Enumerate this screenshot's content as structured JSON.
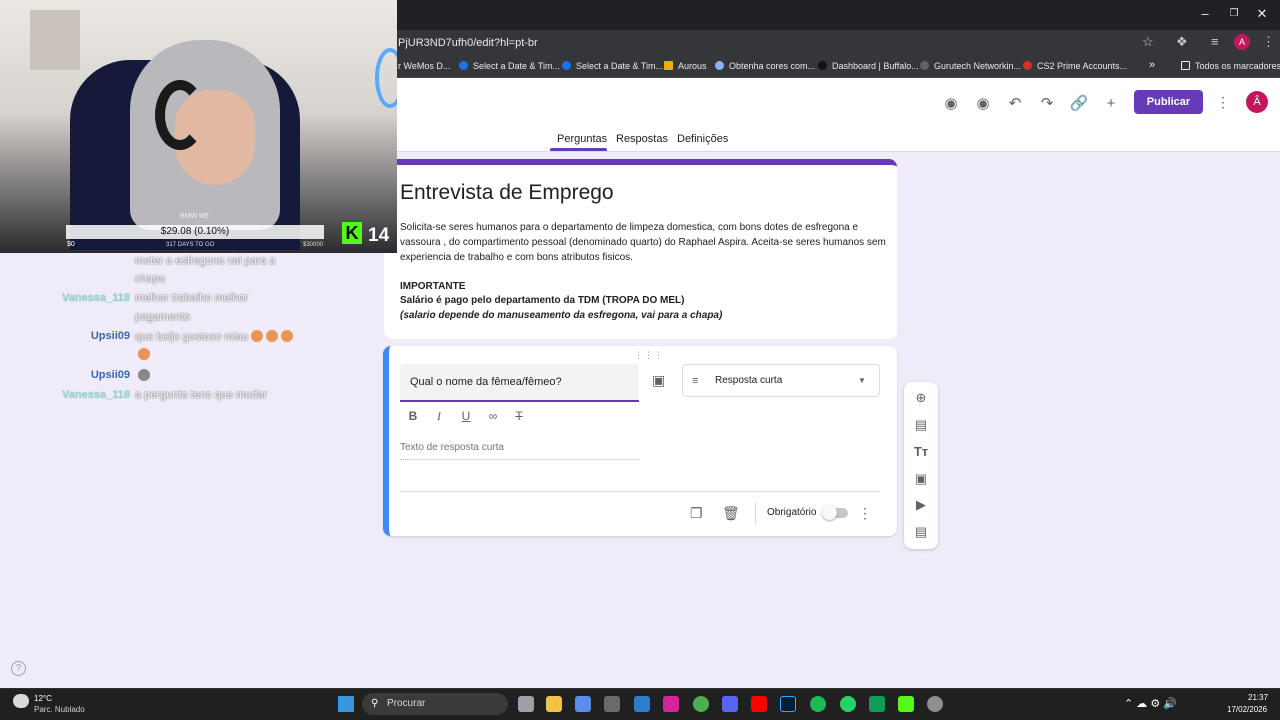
{
  "browser": {
    "url": "PjUR3ND7ufh0/edit?hl=pt-br",
    "profile_initial": "A",
    "bookmarks": [
      {
        "label": "r WeMos D...",
        "color": "#1a73e8"
      },
      {
        "label": "Select a Date & Tim...",
        "color": "#1a73e8"
      },
      {
        "label": "Select a Date & Tim...",
        "color": "#1a73e8"
      },
      {
        "label": "Aurous",
        "color": "#f9ab00"
      },
      {
        "label": "Obtenha cores com...",
        "color": "#8ab4f8"
      },
      {
        "label": "Dashboard | Buffalo...",
        "color": "#202124"
      },
      {
        "label": "Gurutech Networkin...",
        "color": "#5f6368"
      },
      {
        "label": "CS2 Prime Accounts...",
        "color": "#d93025"
      }
    ],
    "bookmarks_more": "»",
    "all_bookmarks": "Todos os marcadores"
  },
  "forms": {
    "publish_label": "Publicar",
    "avatar_initial": "Â",
    "tabs": [
      "Perguntas",
      "Respostas",
      "Definições"
    ],
    "title": "Entrevista de Emprego",
    "description": {
      "paragraph": "Solicita-se seres humanos para o departamento de limpeza domestica, com bons dotes de esfregona e vassoura , do compartimento pessoal (denominado quarto) do Raphael Aspira. Aceita-se seres humanos sem experiencia de trabalho e com bons atributos fisicos.",
      "important": "IMPORTANTE",
      "salary": "Salário é pago pelo departamento da TDM (TROPA DO MEL)",
      "note": "(salario depende do manuseamento da esfregona, vai para a chapa)"
    },
    "question": {
      "text": "Qual o nome da fêmea/fêmeo?",
      "type": "Resposta curta",
      "answer_placeholder": "Texto de resposta curta",
      "required_label": "Obrigatório",
      "required": false
    }
  },
  "stream": {
    "ticker_name": "BMW M5",
    "ticker_price": "$29.08 (0.10%)",
    "ticker_min": "$0",
    "ticker_days": "317 DAYS TO GO",
    "ticker_max": "$30000",
    "viewer_count": "14",
    "chat": [
      {
        "user": "",
        "msg": "meter a esfregona vai para a"
      },
      {
        "user": "",
        "msg": "chapa"
      },
      {
        "user": "Vanessa_118",
        "msg": "melhor trabalho melhor"
      },
      {
        "user": "",
        "msg": "pagamento"
      },
      {
        "user": "Upsii09",
        "msg": "que beijo gostoso miau"
      },
      {
        "user": "Upsii09",
        "msg": ""
      },
      {
        "user": "Vanessa_118",
        "msg": "a pergunta tens que mudar"
      }
    ]
  },
  "taskbar": {
    "weather_temp": "12°C",
    "weather_desc": "Parc. Nublado",
    "search_placeholder": "Procurar",
    "time": "21:37",
    "date": "17/02/2026"
  }
}
